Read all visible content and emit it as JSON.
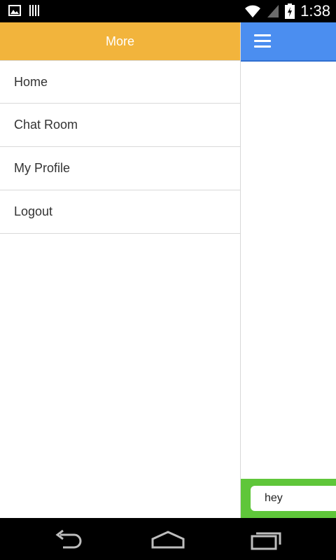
{
  "status_bar": {
    "time": "1:38",
    "icons": [
      "image-icon",
      "barcode-icon",
      "wifi-icon",
      "signal-icon",
      "battery-icon"
    ]
  },
  "drawer": {
    "title": "More",
    "items": [
      {
        "label": "Home"
      },
      {
        "label": "Chat Room"
      },
      {
        "label": "My Profile"
      },
      {
        "label": "Logout"
      }
    ]
  },
  "main": {
    "menu_icon": "hamburger-menu-icon",
    "composer": {
      "value": "hey",
      "placeholder": ""
    }
  },
  "nav_bar": {
    "icons": [
      "back-icon",
      "home-icon",
      "recent-apps-icon"
    ]
  },
  "colors": {
    "drawer_header": "#f2b43c",
    "main_header": "#4b8ef0",
    "composer_bar": "#5fc63a"
  }
}
